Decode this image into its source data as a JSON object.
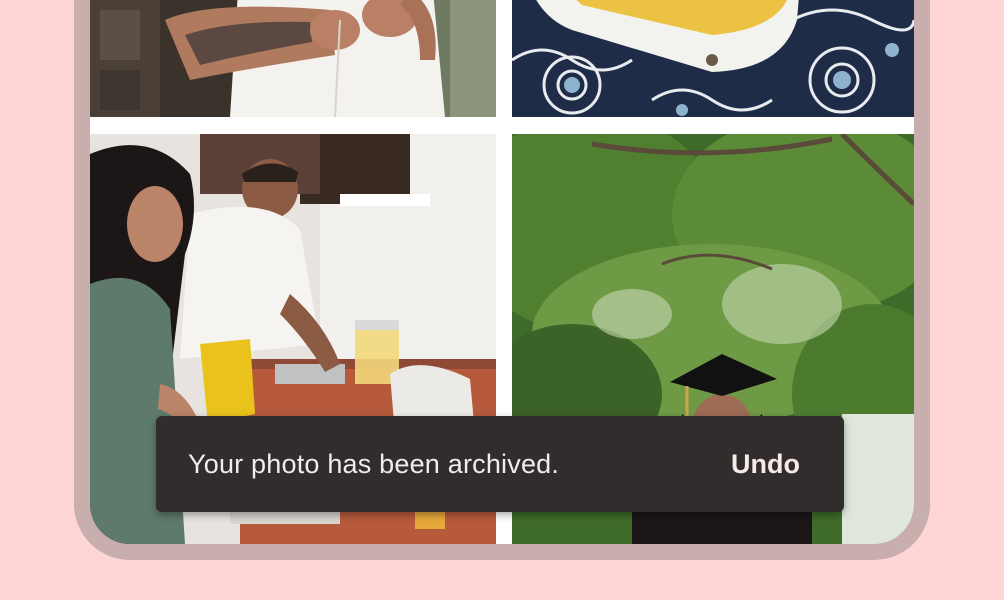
{
  "snackbar": {
    "message": "Your photo has been archived.",
    "action_label": "Undo"
  },
  "photos": [
    {
      "name": "tattooed-arms-white-shirt"
    },
    {
      "name": "chips-bowl-patterned-cloth"
    },
    {
      "name": "couple-cooking-kitchen"
    },
    {
      "name": "graduate-under-tree"
    }
  ],
  "colors": {
    "background": "#ffd6d6",
    "device_frame": "#c9aeae",
    "snackbar_bg": "#322d2d",
    "snackbar_text": "#f1ecec"
  }
}
